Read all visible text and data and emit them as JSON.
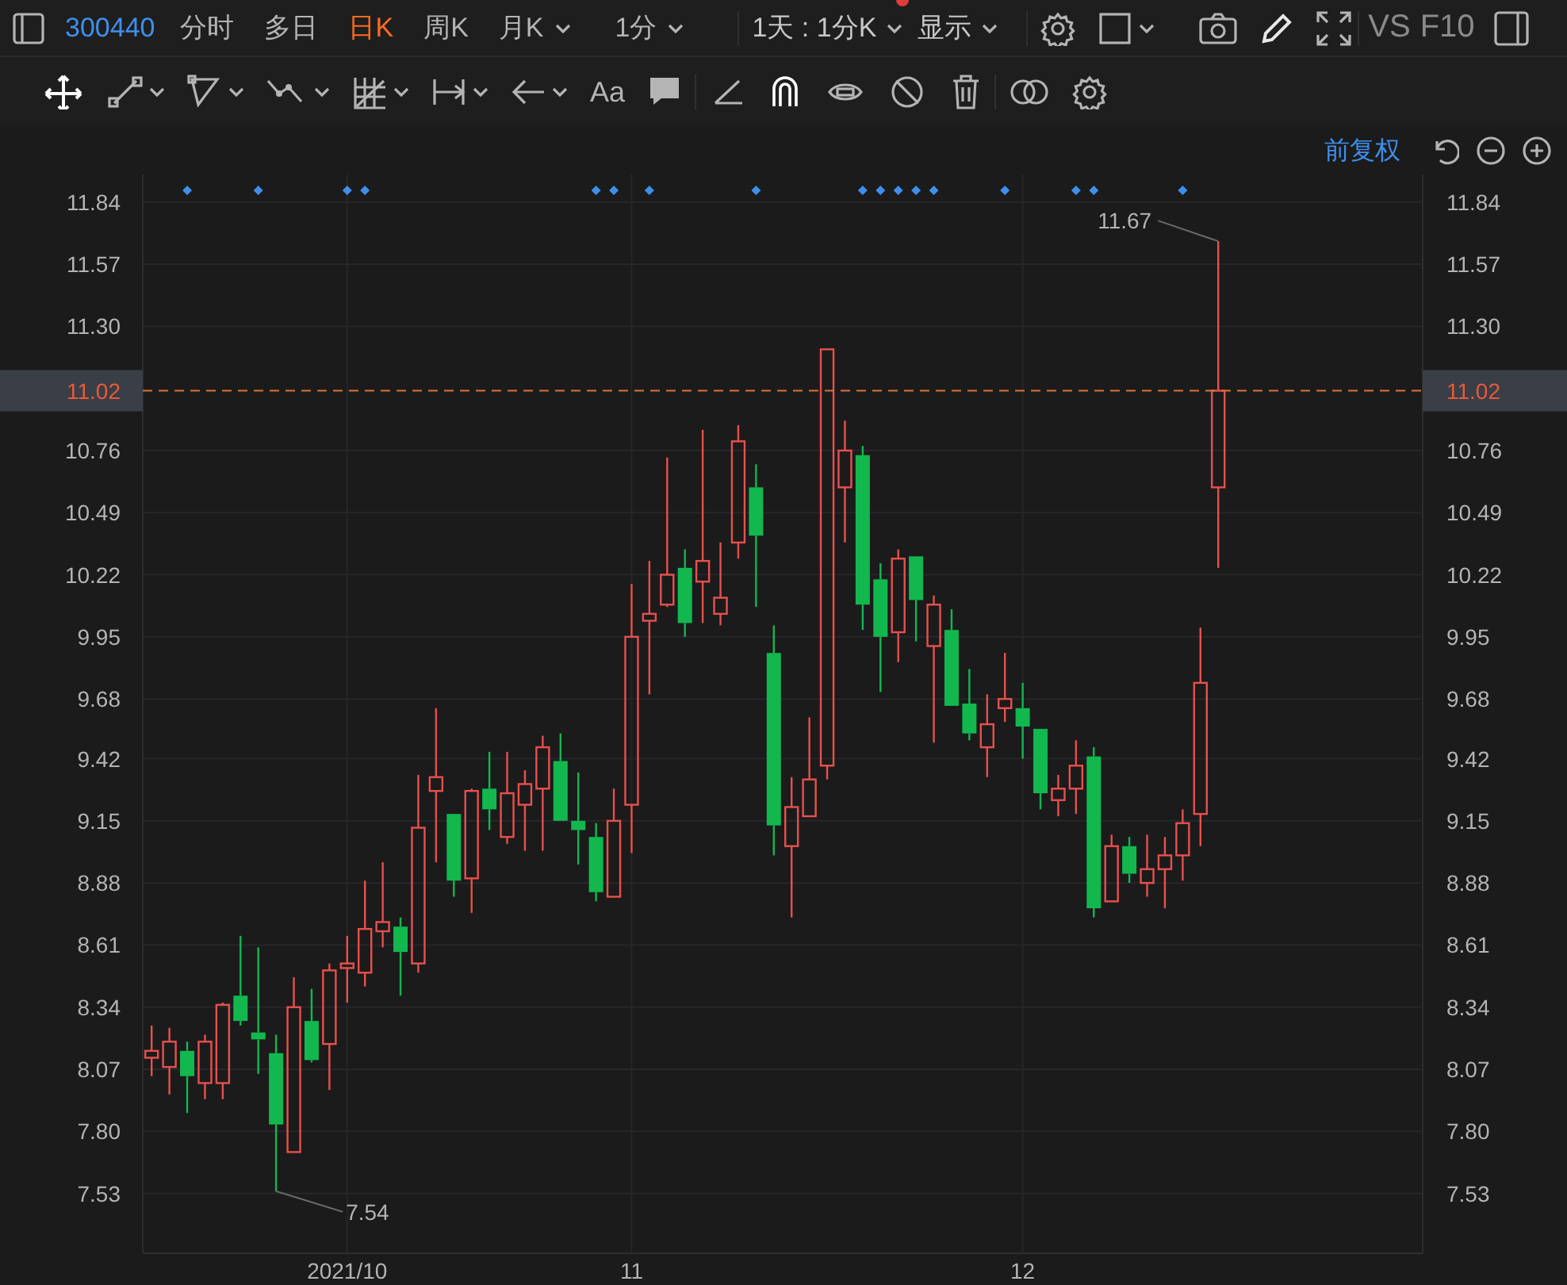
{
  "toolbar": {
    "code": "300440",
    "periods": [
      {
        "label": "分时",
        "selected": false,
        "menu": false
      },
      {
        "label": "多日",
        "selected": false,
        "menu": false
      },
      {
        "label": "日K",
        "selected": true,
        "menu": false
      },
      {
        "label": "周K",
        "selected": false,
        "menu": false
      },
      {
        "label": "月K",
        "selected": false,
        "menu": true
      },
      {
        "label": "1分",
        "selected": false,
        "menu": true
      }
    ],
    "range": {
      "label": "1天 : 1分K",
      "alert": true
    },
    "display": {
      "label": "显示"
    },
    "links": [
      "VS",
      "F10"
    ]
  },
  "drawing_tools": {
    "text_tool": "Aa"
  },
  "adjust": {
    "label": "前复权"
  },
  "chart": {
    "chart_data": {
      "type": "candlestick",
      "grid": true,
      "ylim": [
        7.27,
        11.96
      ],
      "categories": [
        null,
        null,
        null,
        null,
        null,
        null,
        null,
        null,
        null,
        null,
        null,
        "2021/10",
        null,
        null,
        null,
        null,
        null,
        null,
        null,
        null,
        null,
        null,
        null,
        null,
        null,
        null,
        null,
        "11",
        null,
        null,
        null,
        null,
        null,
        null,
        null,
        null,
        null,
        null,
        null,
        null,
        null,
        null,
        null,
        null,
        null,
        null,
        null,
        null,
        null,
        "12",
        null,
        null,
        null,
        null,
        null,
        null,
        null,
        null,
        null,
        null,
        null,
        null,
        null,
        null,
        null,
        null,
        null,
        null,
        null,
        null,
        null,
        null
      ],
      "yticks": [
        11.84,
        11.57,
        {
          "value": 11.3,
          "label": "11.30"
        },
        10.76,
        10.49,
        10.22,
        9.95,
        9.68,
        9.42,
        9.15,
        8.88,
        8.61,
        8.34,
        8.07,
        {
          "value": 7.8,
          "label": "7.80"
        },
        7.53
      ],
      "ohlc": [
        [
          8.12,
          8.26,
          8.04,
          8.15
        ],
        [
          8.08,
          8.25,
          7.96,
          8.19
        ],
        [
          8.15,
          8.19,
          7.88,
          8.04
        ],
        [
          8.01,
          8.22,
          7.94,
          8.19
        ],
        [
          8.01,
          8.36,
          7.94,
          8.35
        ],
        [
          8.39,
          8.65,
          8.26,
          8.28
        ],
        [
          8.23,
          8.6,
          8.05,
          8.2
        ],
        [
          8.14,
          8.22,
          7.54,
          7.83
        ],
        [
          7.71,
          8.47,
          7.71,
          8.34
        ],
        [
          8.28,
          8.42,
          8.1,
          8.11
        ],
        [
          8.18,
          8.53,
          7.98,
          8.5
        ],
        [
          8.51,
          8.65,
          8.36,
          8.53
        ],
        [
          8.49,
          8.89,
          8.43,
          8.68
        ],
        [
          8.67,
          8.97,
          8.6,
          8.71
        ],
        [
          8.69,
          8.73,
          8.39,
          8.58
        ],
        [
          8.53,
          9.35,
          8.49,
          9.12
        ],
        [
          9.28,
          9.64,
          8.97,
          9.34
        ],
        [
          9.18,
          9.18,
          8.82,
          8.89
        ],
        [
          8.9,
          9.29,
          8.75,
          9.28
        ],
        [
          9.29,
          9.45,
          9.11,
          9.2
        ],
        [
          9.08,
          9.45,
          9.05,
          9.27
        ],
        [
          9.22,
          9.37,
          9.02,
          9.31
        ],
        [
          9.29,
          9.52,
          9.02,
          9.47
        ],
        [
          9.41,
          9.53,
          9.15,
          9.15
        ],
        [
          9.15,
          9.36,
          8.96,
          9.11
        ],
        [
          9.08,
          9.14,
          8.8,
          8.84
        ],
        [
          8.82,
          9.29,
          8.82,
          9.15
        ],
        [
          9.22,
          10.18,
          9.01,
          9.95
        ],
        [
          10.02,
          10.28,
          9.7,
          10.05
        ],
        [
          10.09,
          10.73,
          10.08,
          10.22
        ],
        [
          10.25,
          10.33,
          9.95,
          10.01
        ],
        [
          10.19,
          10.85,
          10.01,
          10.28
        ],
        [
          10.05,
          10.36,
          10.0,
          10.12
        ],
        [
          10.36,
          10.87,
          10.29,
          10.8
        ],
        [
          10.6,
          10.7,
          10.08,
          10.39
        ],
        [
          9.88,
          10.0,
          9.0,
          9.13
        ],
        [
          9.04,
          9.34,
          8.73,
          9.21
        ],
        [
          9.17,
          9.6,
          9.17,
          9.33
        ],
        [
          9.39,
          11.2,
          9.33,
          11.2
        ],
        [
          10.6,
          10.89,
          10.36,
          10.76
        ],
        [
          10.74,
          10.78,
          9.98,
          10.09
        ],
        [
          10.2,
          10.27,
          9.71,
          9.95
        ],
        [
          9.97,
          10.33,
          9.84,
          10.29
        ],
        [
          10.3,
          10.3,
          9.93,
          10.11
        ],
        [
          9.91,
          10.13,
          9.49,
          10.09
        ],
        [
          9.98,
          10.07,
          9.65,
          9.65
        ],
        [
          9.66,
          9.81,
          9.5,
          9.53
        ],
        [
          9.47,
          9.7,
          9.34,
          9.57
        ],
        [
          9.64,
          9.88,
          9.58,
          9.68
        ],
        [
          9.64,
          9.75,
          9.42,
          9.56
        ],
        [
          9.55,
          9.55,
          9.2,
          9.27
        ],
        [
          9.24,
          9.35,
          9.17,
          9.29
        ],
        [
          9.29,
          9.5,
          9.18,
          9.39
        ],
        [
          9.43,
          9.47,
          8.73,
          8.77
        ],
        [
          8.8,
          9.09,
          8.8,
          9.04
        ],
        [
          9.04,
          9.08,
          8.88,
          8.92
        ],
        [
          8.88,
          9.09,
          8.82,
          8.94
        ],
        [
          8.94,
          9.08,
          8.77,
          9.0
        ],
        [
          9.0,
          9.2,
          8.89,
          9.14
        ],
        [
          9.18,
          9.99,
          9.04,
          9.75
        ],
        [
          10.6,
          11.67,
          10.25,
          11.02
        ],
        null,
        null,
        null,
        null,
        null,
        null,
        null,
        null,
        null,
        null,
        null
      ],
      "ref_lines": [
        {
          "axis": "y",
          "value": 11.02,
          "label": "11.02"
        }
      ],
      "annotations": [
        "11.67",
        "7.54"
      ]
    },
    "right_axis_labels": [
      "11.84",
      "11.57",
      "11.30",
      "10.76",
      "10.49",
      "10.22",
      "9.95",
      "9.68",
      "9.42",
      "9.15",
      "8.88",
      "8.61",
      "8.34",
      "8.07",
      "7.80",
      "7.53"
    ],
    "right_price_tag": "11.02",
    "event_marks": [
      false,
      false,
      true,
      false,
      false,
      false,
      true,
      false,
      false,
      false,
      false,
      true,
      true,
      false,
      false,
      false,
      false,
      false,
      false,
      false,
      false,
      false,
      false,
      false,
      false,
      true,
      true,
      false,
      true,
      false,
      false,
      false,
      false,
      false,
      true,
      false,
      false,
      false,
      false,
      false,
      true,
      true,
      true,
      true,
      true,
      false,
      false,
      false,
      true,
      false,
      false,
      false,
      true,
      true,
      false,
      false,
      false,
      false,
      true,
      false,
      false
    ]
  }
}
